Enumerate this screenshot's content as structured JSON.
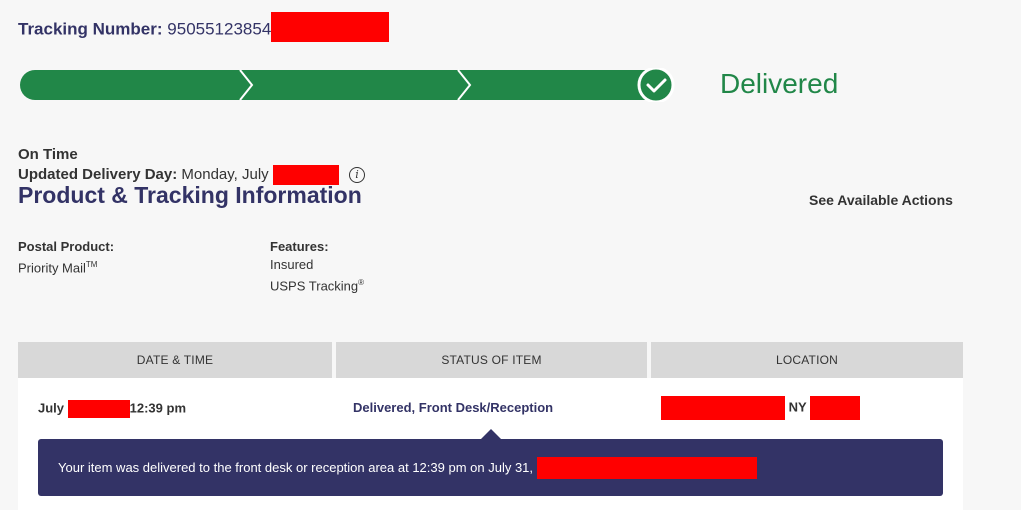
{
  "tracking": {
    "label": "Tracking Number:",
    "number_visible": "95055123854"
  },
  "progress": {
    "steps_total": 4,
    "steps_completed": 4,
    "status": "Delivered"
  },
  "delivery": {
    "ontime": "On Time",
    "updated_label": "Updated Delivery Day:",
    "updated_value": "Monday, July"
  },
  "product_section": {
    "title": "Product & Tracking Information",
    "see_actions": "See Available Actions",
    "postal_label": "Postal Product:",
    "postal_value": "Priority Mail",
    "postal_sup": "TM",
    "features_label": "Features:",
    "features": [
      "Insured",
      "USPS Tracking"
    ],
    "features_sup": "®"
  },
  "table": {
    "headers": [
      "DATE & TIME",
      "STATUS OF ITEM",
      "LOCATION"
    ],
    "row": {
      "date_prefix": "July",
      "time": "12:39 pm",
      "status": "Delivered, Front Desk/Reception",
      "location_state": "NY"
    },
    "detail": "Your item was delivered to the front desk or reception area at 12:39 pm on July 31,"
  },
  "colors": {
    "green": "#218748",
    "navy": "#333366",
    "redaction": "#ff0000"
  }
}
